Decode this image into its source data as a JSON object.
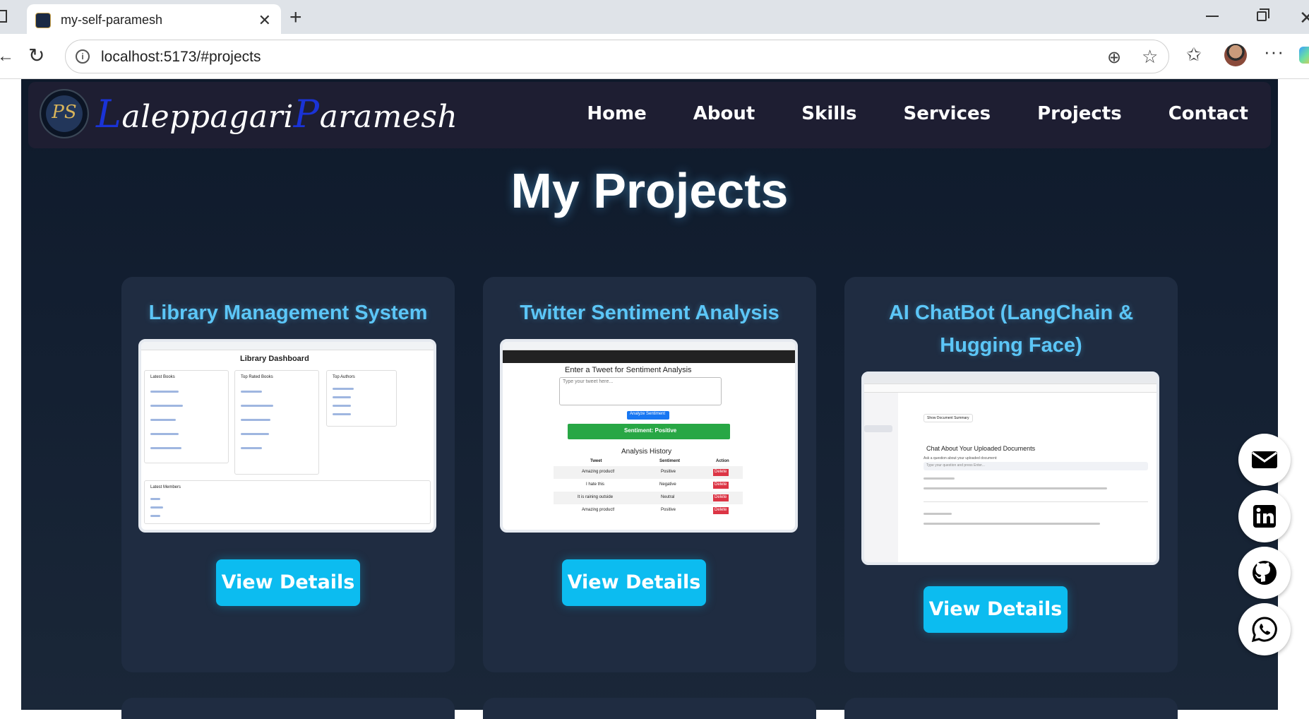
{
  "browser": {
    "tab_title": "my-self-paramesh",
    "url": "localhost:5173/#projects"
  },
  "site": {
    "logo_text": "PS",
    "brand_first_initial": "L",
    "brand_first_rest": "aleppagari",
    "brand_last_initial": "P",
    "brand_last_rest": "aramesh",
    "nav": [
      "Home",
      "About",
      "Skills",
      "Services",
      "Projects",
      "Contact"
    ]
  },
  "projects_section": {
    "title": "My Projects",
    "cards": [
      {
        "title": "Library Management System",
        "button": "View Details",
        "screenshot": {
          "heading": "Library Dashboard",
          "panels": [
            "Latest Books",
            "Top Rated Books",
            "Top Authors"
          ],
          "members_header": "Latest Members"
        }
      },
      {
        "title": "Twitter Sentiment Analysis",
        "button": "View Details",
        "screenshot": {
          "heading": "Enter a Tweet for Sentiment Analysis",
          "placeholder": "Type your tweet here...",
          "analyze_button": "Analyze Sentiment",
          "result": "Sentiment: Positive",
          "history_title": "Analysis History",
          "columns": [
            "Tweet",
            "Sentiment",
            "Action"
          ],
          "rows": [
            [
              "Amazing product!",
              "Positive",
              "Delete"
            ],
            [
              "I hate this",
              "Negative",
              "Delete"
            ],
            [
              "It is raining outside",
              "Neutral",
              "Delete"
            ],
            [
              "Amazing product!",
              "Positive",
              "Delete"
            ]
          ]
        }
      },
      {
        "title": "AI ChatBot (LangChain & Hugging Face)",
        "button": "View Details",
        "screenshot": {
          "summary_button": "Show Document Summary",
          "chat_title": "Chat About Your Uploaded Documents",
          "ask_label": "Ask a question about your uploaded document:",
          "input_placeholder": "Type your question and press Enter..."
        }
      }
    ]
  },
  "social_icons": [
    "mail-icon",
    "linkedin-icon",
    "github-icon",
    "whatsapp-icon"
  ],
  "colors": {
    "accent": "#0cbcf0",
    "card_title": "#5cc6f7",
    "card_bg": "#1f2c41",
    "navbar_bg": "#1e1e32",
    "brand_initials": "#1a33d6"
  }
}
